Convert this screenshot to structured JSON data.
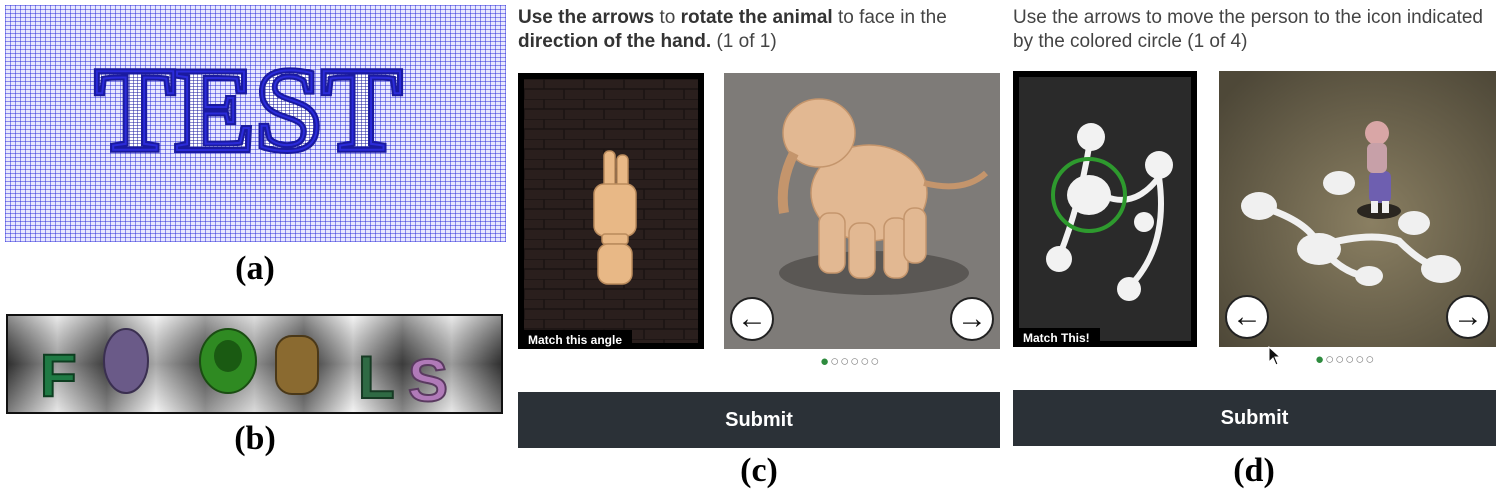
{
  "panel_a": {
    "text": "TEST",
    "caption": "(a)"
  },
  "panel_b": {
    "text": "FCODLS",
    "caption": "(b)"
  },
  "panel_c": {
    "instruction": {
      "p1": "Use the arrows",
      "p2": " to ",
      "p3": "rotate the animal",
      "p4": " to face in the ",
      "p5": "direction of the hand.",
      "p6": " (1 of 1)"
    },
    "reference_label": "Match this angle",
    "left_arrow": "←",
    "right_arrow": "→",
    "dots": {
      "active": "●",
      "inactive": "○○○○○"
    },
    "submit": "Submit",
    "caption": "(c)"
  },
  "panel_d": {
    "instruction": "Use the arrows to move the person to the icon indicated by the colored circle (1 of 4)",
    "reference_label": "Match This!",
    "left_arrow": "←",
    "right_arrow": "→",
    "dots": {
      "active": "●",
      "inactive": "○○○○○"
    },
    "submit": "Submit",
    "caption": "(d)"
  },
  "colors": {
    "grid_blue": "#2b2bd9",
    "submit_bg": "#2b3137",
    "dot_active": "#2e8b3e",
    "circle_green": "#2e9a2e"
  }
}
